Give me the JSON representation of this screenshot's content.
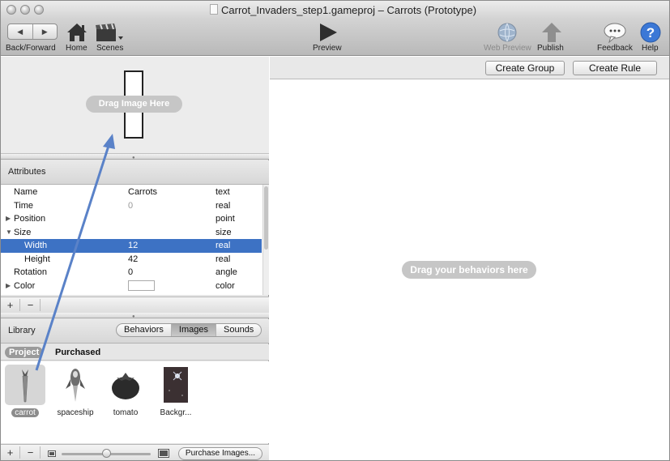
{
  "window": {
    "title": "Carrot_Invaders_step1.gameproj – Carrots (Prototype)"
  },
  "toolbar": {
    "back_forward": "Back/Forward",
    "home": "Home",
    "scenes": "Scenes",
    "preview": "Preview",
    "web_preview": "Web Preview",
    "publish": "Publish",
    "feedback": "Feedback",
    "help": "Help",
    "back_glyph": "◀",
    "forward_glyph": "▶",
    "icons": [
      "home-icon",
      "scenes-clapperboard-icon",
      "play-icon",
      "globe-icon",
      "upload-arrow-icon",
      "speech-bubble-icon",
      "question-icon"
    ]
  },
  "image_drop": {
    "label": "Drag Image Here"
  },
  "attributes": {
    "header": "Attributes",
    "rows": [
      {
        "name": "Name",
        "value": "Carrots",
        "type": "text"
      },
      {
        "name": "Time",
        "value": "0",
        "type": "real"
      },
      {
        "name": "Position",
        "value": "",
        "type": "point",
        "disclosure": "▶"
      },
      {
        "name": "Size",
        "value": "",
        "type": "size",
        "disclosure": "▼"
      },
      {
        "name": "Width",
        "value": "12",
        "type": "real"
      },
      {
        "name": "Height",
        "value": "42",
        "type": "real"
      },
      {
        "name": "Rotation",
        "value": "0",
        "type": "angle"
      },
      {
        "name": "Color",
        "value": "",
        "type": "color",
        "disclosure": "▶"
      }
    ],
    "add": "+",
    "remove": "−"
  },
  "library": {
    "header": "Library",
    "tabs": [
      "Behaviors",
      "Images",
      "Sounds"
    ],
    "active_tab": "Images",
    "subtabs": [
      "Project",
      "Purchased"
    ],
    "active_subtab": "Project",
    "items": [
      {
        "label": "carrot",
        "icon": "carrot-image"
      },
      {
        "label": "spaceship",
        "icon": "spaceship-image"
      },
      {
        "label": "tomato",
        "icon": "tomato-image"
      },
      {
        "label": "Backgr...",
        "icon": "background-image"
      }
    ],
    "selected_item": "carrot",
    "footer_add": "+",
    "footer_remove": "−",
    "purchase": "Purchase Images..."
  },
  "behaviors": {
    "create_group": "Create Group",
    "create_rule": "Create Rule",
    "drop_label": "Drag your behaviors here"
  },
  "colors": {
    "selection": "#3d72c4",
    "annotation_arrow": "#5a82c8",
    "pill": "#c6c6c6"
  }
}
